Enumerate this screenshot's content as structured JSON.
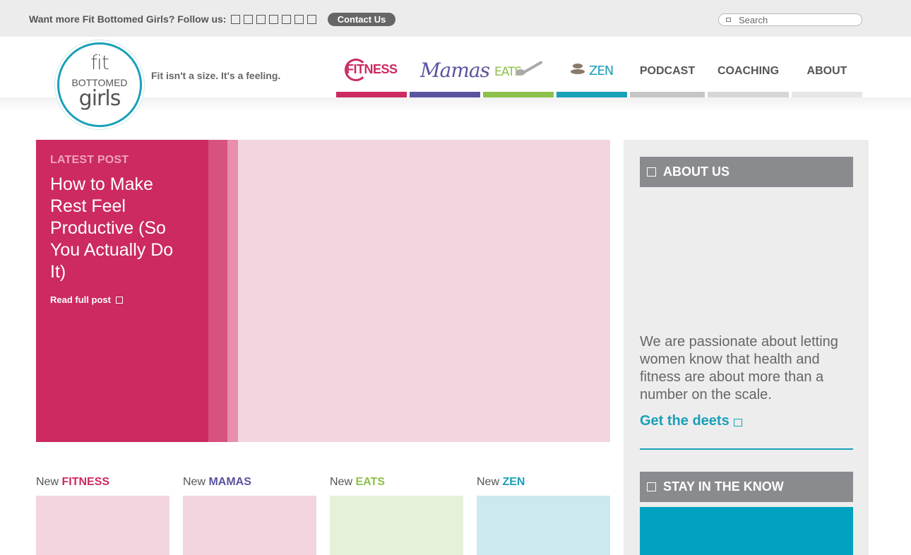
{
  "topbar": {
    "follow_text": "Want more Fit Bottomed Girls? Follow us:",
    "social_icons": [
      "social-icon-1",
      "social-icon-2",
      "social-icon-3",
      "social-icon-4",
      "social-icon-5",
      "social-icon-6",
      "social-icon-7"
    ],
    "contact_label": "Contact Us",
    "search_placeholder": "Search"
  },
  "header": {
    "logo": {
      "line1": "fit",
      "line2": "BOTTOMED",
      "line3": "girls"
    },
    "tagline": "Fit isn't a size. It's a feeling."
  },
  "nav": {
    "fitness": {
      "label": "FITNESS",
      "color": "#cc2a61"
    },
    "mamas": {
      "label": "Mamas",
      "color": "#5a54a0"
    },
    "eats": {
      "label": "EATS",
      "color": "#8cc04a"
    },
    "zen": {
      "label": "ZEN",
      "color": "#1aa0b8"
    },
    "podcast": {
      "label": "PODCAST"
    },
    "coaching": {
      "label": "COACHING"
    },
    "about": {
      "label": "ABOUT"
    }
  },
  "hero": {
    "kicker": "LATEST POST",
    "title": "How to Make Rest Feel Productive (So You Actually Do It)",
    "read_more": "Read full post"
  },
  "categories": [
    {
      "prefix": "New",
      "name": "FITNESS",
      "color": "#cc2a61"
    },
    {
      "prefix": "New",
      "name": "MAMAS",
      "color": "#5a54a0"
    },
    {
      "prefix": "New",
      "name": "EATS",
      "color": "#8cc04a"
    },
    {
      "prefix": "New",
      "name": "ZEN",
      "color": "#1aa0b8"
    }
  ],
  "sidebar": {
    "about_heading": "ABOUT US",
    "about_text": "We are passionate about letting women know that health and fitness are about more than a number on the scale.",
    "deets_link": "Get the deets",
    "newsletter_heading": "STAY IN THE KNOW"
  },
  "colors": {
    "accent_pink": "#cc2a61",
    "accent_purple": "#5a54a0",
    "accent_green": "#8cc04a",
    "accent_teal": "#1aa0b8"
  }
}
